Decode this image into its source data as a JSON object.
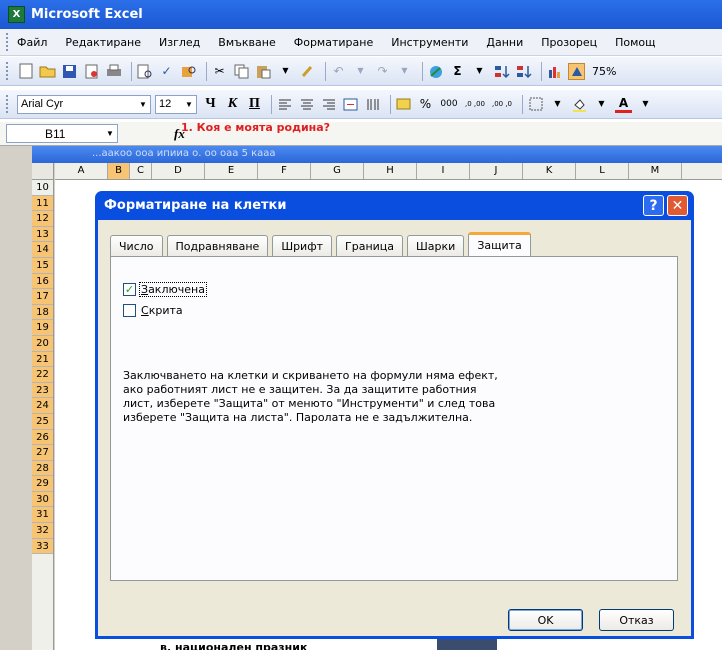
{
  "app": {
    "title": "Microsoft Excel",
    "logo": "X"
  },
  "menu": [
    "Файл",
    "Редактиране",
    "Изглед",
    "Вмъкване",
    "Форматиране",
    "Инструменти",
    "Данни",
    "Прозорец",
    "Помощ"
  ],
  "standard_toolbar": {
    "zoom": "75%"
  },
  "format_toolbar": {
    "font": "Arial Cyr",
    "size": "12",
    "bold_glyph": "Ч",
    "italic_glyph": "К",
    "underline_glyph": "П",
    "percent": "%",
    "thousands": "000",
    "inc_decimal": ",0 ,00",
    "dec_decimal": ",00 ,0"
  },
  "formula_bar": {
    "name_box": "B11",
    "fx": "fx"
  },
  "worksheet": {
    "window_title": "...аакоо ооа ипииа о. оо оаа 5 кааа",
    "columns": [
      "A",
      "B",
      "C",
      "D",
      "E",
      "F",
      "G",
      "H",
      "I",
      "J",
      "K",
      "L",
      "M"
    ],
    "selected_column": "B",
    "rows": [
      "10",
      "11",
      "12",
      "13",
      "14",
      "15",
      "16",
      "17",
      "18",
      "19",
      "20",
      "21",
      "22",
      "23",
      "24",
      "25",
      "26",
      "27",
      "28",
      "29",
      "30",
      "31",
      "32",
      "33"
    ],
    "red_text": "1. Коя е моята родина?",
    "bottom_text": "в.  национален празник"
  },
  "dialog": {
    "title": "Форматиране на клетки",
    "help": "?",
    "close": "✕",
    "tabs": [
      "Число",
      "Подравняване",
      "Шрифт",
      "Граница",
      "Шарки",
      "Защита"
    ],
    "active_tab": "Защита",
    "locked": {
      "label_u": "З",
      "label_rest": "аключена",
      "checked": true
    },
    "hidden": {
      "label_u": "С",
      "label_rest": "крита",
      "checked": false
    },
    "info": "Заключването на клетки и скриването на формули няма ефект,\nако работният лист не е защитен. За да защитите работния\nлист, изберете \"Защита\" от менюто \"Инструменти\" и след това\nизберете \"Защита на листа\". Паролата не е задължителна.",
    "ok": "OK",
    "cancel": "Отказ"
  }
}
